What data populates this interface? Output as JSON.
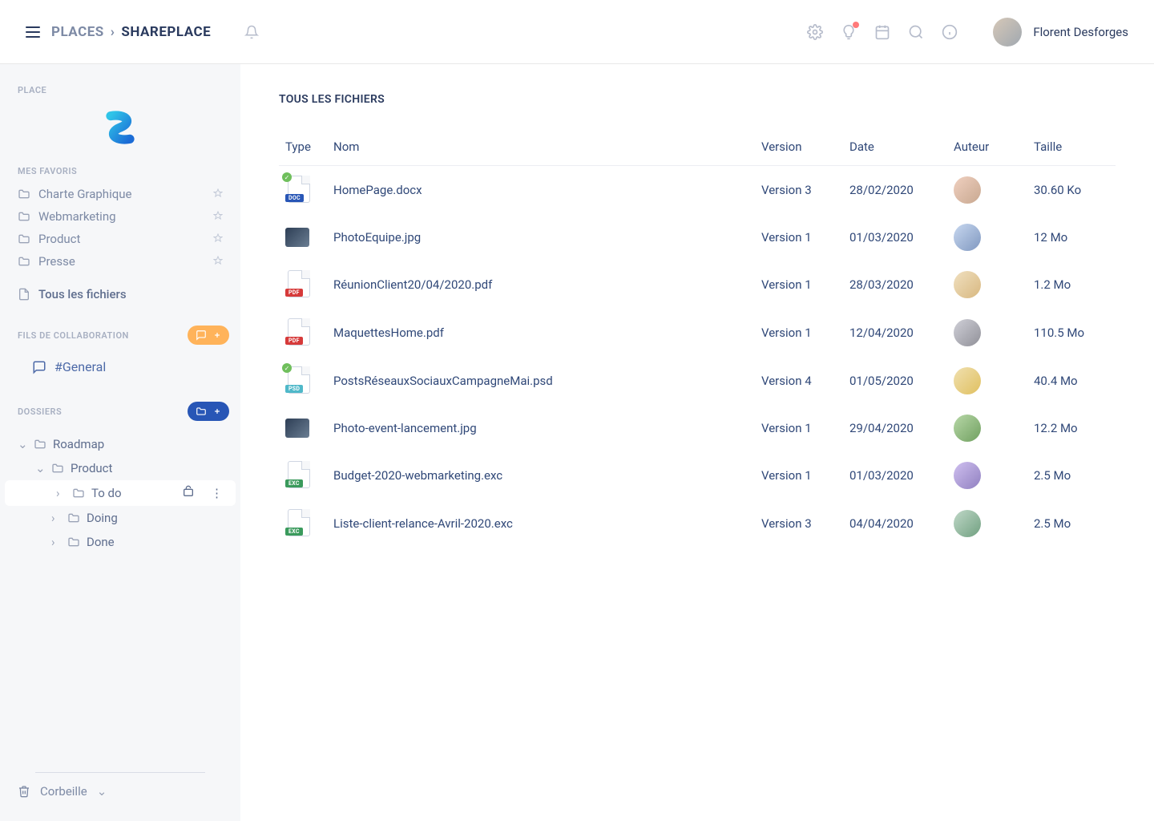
{
  "header": {
    "breadcrumb_root": "PLACES",
    "breadcrumb_app": "SHAREPLACE",
    "user_name": "Florent Desforges"
  },
  "sidebar": {
    "place_label": "PLACE",
    "favorites_label": "MES FAVORIS",
    "favorites": [
      {
        "label": "Charte Graphique"
      },
      {
        "label": "Webmarketing"
      },
      {
        "label": "Product"
      },
      {
        "label": "Presse"
      }
    ],
    "all_files_label": "Tous les fichiers",
    "collab_label": "FILS DE COLLABORATION",
    "channel_label": "#General",
    "dossiers_label": "DOSSIERS",
    "tree": {
      "root": "Roadmap",
      "child": "Product",
      "leaves": [
        {
          "label": "To do",
          "selected": true
        },
        {
          "label": "Doing",
          "selected": false
        },
        {
          "label": "Done",
          "selected": false
        }
      ]
    },
    "trash_label": "Corbeille"
  },
  "main": {
    "title": "TOUS LES FICHIERS",
    "columns": {
      "type": "Type",
      "name": "Nom",
      "version": "Version",
      "date": "Date",
      "author": "Auteur",
      "size": "Taille"
    },
    "rows": [
      {
        "icon": "doc",
        "name": "HomePage.docx",
        "version": "Version 3",
        "date": "28/02/2020",
        "author": "av1",
        "size": "30.60 Ko",
        "check": true
      },
      {
        "icon": "thumb",
        "name": "PhotoEquipe.jpg",
        "version": "Version 1",
        "date": "01/03/2020",
        "author": "av2",
        "size": "12 Mo"
      },
      {
        "icon": "pdf",
        "name": "RéunionClient20/04/2020.pdf",
        "version": "Version 1",
        "date": "28/03/2020",
        "author": "av3",
        "size": "1.2 Mo"
      },
      {
        "icon": "pdf",
        "name": "MaquettesHome.pdf",
        "version": "Version 1",
        "date": "12/04/2020",
        "author": "av4",
        "size": "110.5 Mo"
      },
      {
        "icon": "psd",
        "name": "PostsRéseauxSociauxCampagneMai.psd",
        "version": "Version 4",
        "date": "01/05/2020",
        "author": "av5",
        "size": "40.4 Mo",
        "check": true
      },
      {
        "icon": "thumb",
        "name": "Photo-event-lancement.jpg",
        "version": "Version 1",
        "date": "29/04/2020",
        "author": "av6",
        "size": "12.2 Mo"
      },
      {
        "icon": "exc",
        "name": "Budget-2020-webmarketing.exc",
        "version": "Version 1",
        "date": "01/03/2020",
        "author": "av7",
        "size": "2.5 Mo"
      },
      {
        "icon": "exc",
        "name": "Liste-client-relance-Avril-2020.exc",
        "version": "Version 3",
        "date": "04/04/2020",
        "author": "av8",
        "size": "2.5 Mo"
      }
    ]
  }
}
